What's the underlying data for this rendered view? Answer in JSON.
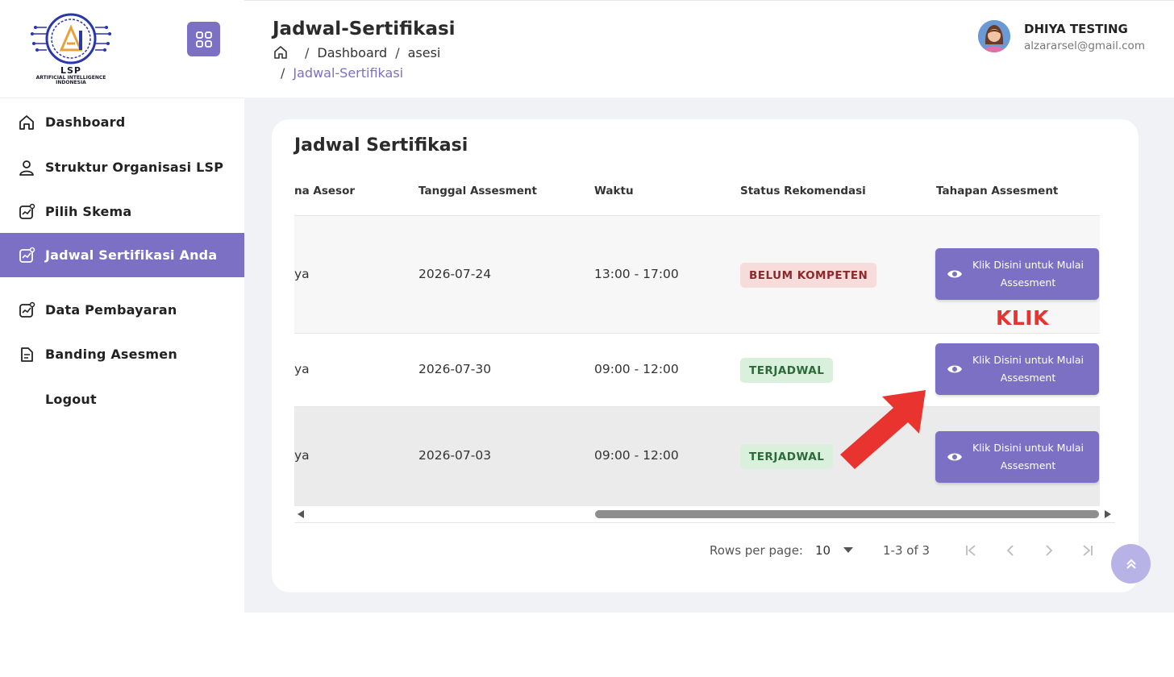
{
  "sidebar": {
    "logo": {
      "title": "LSP",
      "subtitle": "ARTIFICIAL INTELLIGENCE INDONESIA"
    },
    "items": [
      {
        "label": "Dashboard",
        "icon": "home-icon"
      },
      {
        "label": "Struktur Organisasi LSP",
        "icon": "user-icon"
      },
      {
        "label": "Pilih Skema",
        "icon": "chart-icon"
      },
      {
        "label": "Jadwal Sertifikasi Anda",
        "icon": "chart-icon",
        "active": true
      },
      {
        "label": "Data Pembayaran",
        "icon": "chart-icon"
      },
      {
        "label": "Banding Asesmen",
        "icon": "document-icon"
      },
      {
        "label": "Logout",
        "icon": ""
      }
    ]
  },
  "header": {
    "title": "Jadwal-Sertifikasi",
    "breadcrumb": [
      "Dashboard",
      "asesi"
    ],
    "breadcrumb_current": "Jadwal-Sertifikasi",
    "user": {
      "name": "DHIYA TESTING",
      "email": "alzararsel@gmail.com"
    }
  },
  "card": {
    "title": "Jadwal Sertifikasi",
    "columns": [
      "na Asesor",
      "Tanggal Assesment",
      "Waktu",
      "Status Rekomendasi",
      "Tahapan Assesment"
    ],
    "rows": [
      {
        "asesor": "ya",
        "tanggal": "2026-07-24",
        "waktu": "13:00 - 17:00",
        "status": "BELUM KOMPETEN",
        "status_color": "#f7dcdc",
        "action": "Klik Disini untuk Mulai Assesment"
      },
      {
        "asesor": "ya",
        "tanggal": "2026-07-30",
        "waktu": "09:00 - 12:00",
        "status": "TERJADWAL",
        "status_color": "#d8f0dc",
        "action": "Klik Disini untuk Mulai Assesment"
      },
      {
        "asesor": "ya",
        "tanggal": "2026-07-03",
        "waktu": "09:00 - 12:00",
        "status": "TERJADWAL",
        "status_color": "#d8f0dc",
        "action": "Klik Disini untuk Mulai Assesment"
      }
    ],
    "pagination": {
      "rows_per_page_label": "Rows per page:",
      "rows_per_page_value": "10",
      "range": "1-3 of 3"
    }
  },
  "annotation": {
    "text": "KLIK",
    "color": "#e8332f"
  },
  "colors": {
    "accent": "#7b70c4",
    "fab": "#b8b3e6"
  }
}
